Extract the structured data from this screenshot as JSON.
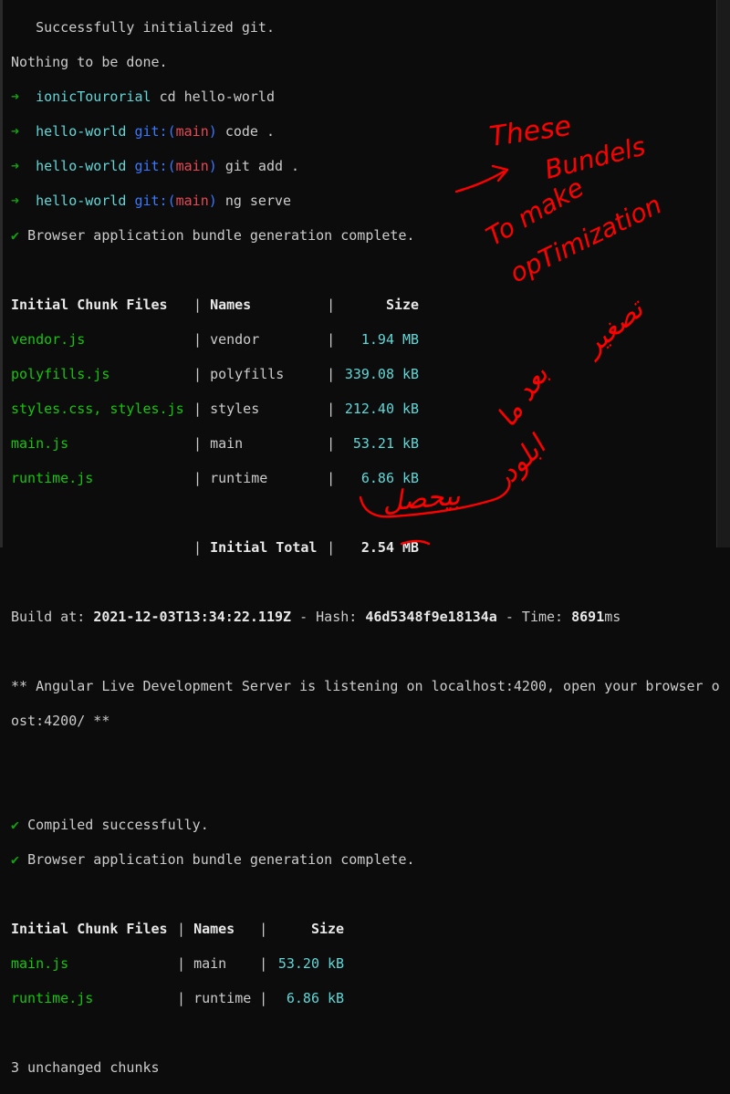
{
  "init": {
    "msg": "   Successfully initialized git.",
    "nothing": "Nothing to be done."
  },
  "prompts": [
    {
      "dir": "ionicTourorial",
      "git": "",
      "branch": "",
      "cmd": "cd hello-world"
    },
    {
      "dir": "hello-world",
      "git": "git:(",
      "branch": "main",
      "cmd": "code ."
    },
    {
      "dir": "hello-world",
      "git": "git:(",
      "branch": "main",
      "cmd": "git add ."
    },
    {
      "dir": "hello-world",
      "git": "git:(",
      "branch": "main",
      "cmd": "ng serve"
    }
  ],
  "bundle1": "Browser application bundle generation complete.",
  "table1": {
    "header": {
      "files": "Initial Chunk Files",
      "names": "Names",
      "size": "Size"
    },
    "rows": [
      {
        "file": "vendor.js",
        "name": "vendor",
        "size": "1.94 MB"
      },
      {
        "file": "polyfills.js",
        "name": "polyfills",
        "size": "339.08 kB"
      },
      {
        "file": "styles.css, styles.js",
        "name": "styles",
        "size": "212.40 kB"
      },
      {
        "file": "main.js",
        "name": "main",
        "size": "53.21 kB"
      },
      {
        "file": "runtime.js",
        "name": "runtime",
        "size": "6.86 kB"
      }
    ],
    "total_label": "Initial Total",
    "total_value": "2.54 MB"
  },
  "build": {
    "build_label": "Build at: ",
    "date": "2021-12-03T13:34:22.119Z",
    "hash_label": " - Hash: ",
    "hash": "46d5348f9e18134a",
    "time_label": " - Time: ",
    "time": "8691",
    "time_unit": "ms"
  },
  "server": {
    "line1": "** Angular Live Development Server is listening on localhost:4200, open your browser o",
    "line2": "ost:4200/ **"
  },
  "compiled": "Compiled successfully.",
  "bundle2": "Browser application bundle generation complete.",
  "table2": {
    "header": {
      "files": "Initial Chunk Files",
      "names": "Names",
      "size": "Size"
    },
    "rows": [
      {
        "file": "main.js",
        "name": "main",
        "size": "53.20 kB"
      },
      {
        "file": "runtime.js",
        "name": "runtime",
        "size": "6.86 kB"
      }
    ]
  },
  "unchanged": "3 unchanged chunks",
  "symbols": {
    "arrow": "➜",
    "check": "✔",
    "sep": "|"
  },
  "annotations": {
    "en_line1": "These",
    "en_line2": "Bundels",
    "en_line3": "To make",
    "en_line4": "opTimization",
    "ar_line1": "تصغير",
    "ar_line2": "بعد ما",
    "ar_line3": "ابلود",
    "ar_line4": "بيحصل"
  },
  "colors": {
    "background": "#0c0c0c",
    "ink": "#ff0000",
    "green": "#16c60c",
    "cyan": "#3a96dd",
    "red": "#e74856",
    "teal": "#61d6d6"
  }
}
